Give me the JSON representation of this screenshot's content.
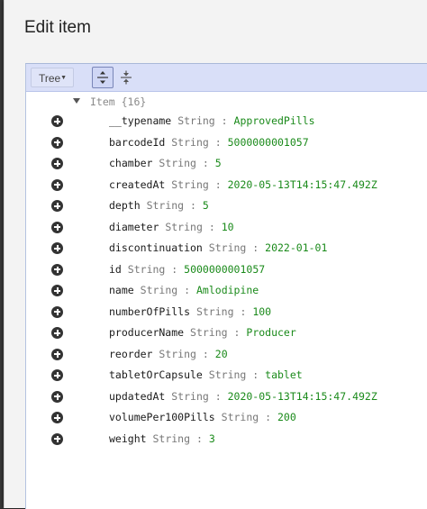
{
  "dialog": {
    "title": "Edit item"
  },
  "menubar": {
    "mode": "Tree"
  },
  "tree": {
    "root_label": "Item {16}",
    "separator": ":",
    "fields": [
      {
        "key": "__typename",
        "type": "String",
        "value": "ApprovedPills"
      },
      {
        "key": "barcodeId",
        "type": "String",
        "value": "5000000001057"
      },
      {
        "key": "chamber",
        "type": "String",
        "value": "5"
      },
      {
        "key": "createdAt",
        "type": "String",
        "value": "2020-05-13T14:15:47.492Z"
      },
      {
        "key": "depth",
        "type": "String",
        "value": "5"
      },
      {
        "key": "diameter",
        "type": "String",
        "value": "10"
      },
      {
        "key": "discontinuation",
        "type": "String",
        "value": "2022-01-01"
      },
      {
        "key": "id",
        "type": "String",
        "value": "5000000001057"
      },
      {
        "key": "name",
        "type": "String",
        "value": "Amlodipine"
      },
      {
        "key": "numberOfPills",
        "type": "String",
        "value": "100"
      },
      {
        "key": "producerName",
        "type": "String",
        "value": "Producer"
      },
      {
        "key": "reorder",
        "type": "String",
        "value": "20"
      },
      {
        "key": "tabletOrCapsule",
        "type": "String",
        "value": "tablet"
      },
      {
        "key": "updatedAt",
        "type": "String",
        "value": "2020-05-13T14:15:47.492Z"
      },
      {
        "key": "volumePer100Pills",
        "type": "String",
        "value": "200"
      },
      {
        "key": "weight",
        "type": "String",
        "value": "3"
      }
    ]
  }
}
